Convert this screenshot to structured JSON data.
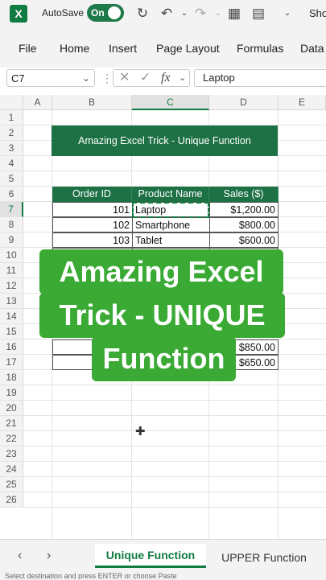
{
  "titlebar": {
    "app_logo": "X",
    "autosave_label": "AutoSave",
    "autosave_state": "On",
    "user_truncated": "Sho"
  },
  "ribbon": {
    "tabs": [
      "File",
      "Home",
      "Insert",
      "Page Layout",
      "Formulas",
      "Data"
    ]
  },
  "formula_bar": {
    "name_box": "C7",
    "fx": "fx",
    "value": "Laptop"
  },
  "grid": {
    "columns": [
      "A",
      "B",
      "C",
      "D",
      "E"
    ],
    "rows": [
      "1",
      "2",
      "3",
      "4",
      "5",
      "6",
      "7",
      "8",
      "9",
      "10",
      "11",
      "12",
      "13",
      "14",
      "15",
      "16",
      "17",
      "18",
      "19",
      "20",
      "21",
      "22",
      "23",
      "24",
      "25",
      "26"
    ],
    "selected_column": "C",
    "selected_row": "7"
  },
  "sheet": {
    "title": "Amazing Excel Trick - Unique Function",
    "headers": [
      "Order ID",
      "Product Name",
      "Sales ($)"
    ],
    "rows": [
      {
        "id": "101",
        "product": "Laptop",
        "sales": "$1,200.00"
      },
      {
        "id": "102",
        "product": "Smartphone",
        "sales": "$800.00"
      },
      {
        "id": "103",
        "product": "Tablet",
        "sales": "$600.00"
      }
    ],
    "lower_rows": [
      {
        "sales": "$850.00"
      },
      {
        "sales": "$650.00"
      }
    ]
  },
  "overlay": {
    "line1": "Amazing Excel",
    "line2": "Trick - UNIQUE",
    "line3": "Function"
  },
  "sheet_tabs": {
    "active": "Unique Function",
    "other": "UPPER Function"
  },
  "status": {
    "text": "Select destination and press ENTER or choose Paste"
  },
  "colors": {
    "excel_green": "#107c41",
    "header_green": "#1e7145",
    "overlay_green": "#3aaa35"
  }
}
